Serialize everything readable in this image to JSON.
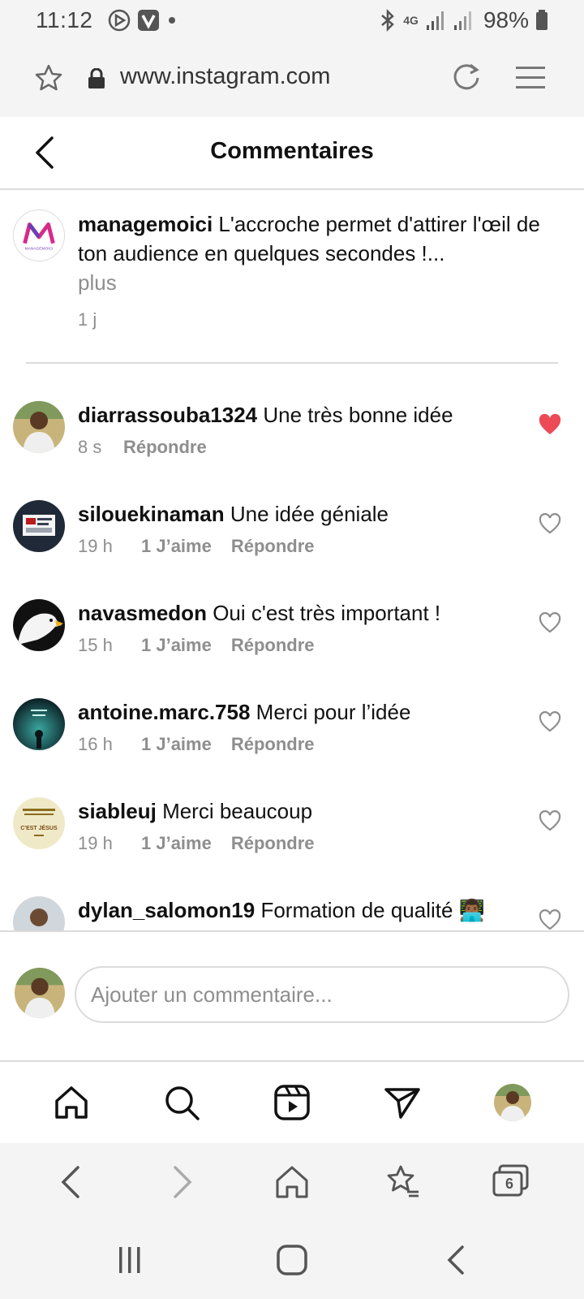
{
  "status_bar": {
    "time": "11:12",
    "network": "4G",
    "battery": "98%"
  },
  "browser": {
    "url": "www.instagram.com",
    "tab_count": "6"
  },
  "header": {
    "title": "Commentaires"
  },
  "caption": {
    "username": "managemoici",
    "text": "L'accroche permet d'attirer l'œil de ton audience en quelques secondes !...",
    "more_label": "plus",
    "time": "1 j",
    "avatar_text": "MANAGEMOICI"
  },
  "comments": [
    {
      "username": "diarrassouba1324",
      "text": "Une très bonne idée",
      "time": "8 s",
      "likes": "",
      "reply_label": "Répondre",
      "liked": true
    },
    {
      "username": "silouekinaman",
      "text": "Une idée géniale",
      "time": "19 h",
      "likes": "1 J’aime",
      "reply_label": "Répondre",
      "liked": false
    },
    {
      "username": "navasmedon",
      "text": "Oui c'est très important !",
      "time": "15 h",
      "likes": "1 J’aime",
      "reply_label": "Répondre",
      "liked": false
    },
    {
      "username": "antoine.marc.758",
      "text": "Merci pour l’idée",
      "time": "16 h",
      "likes": "1 J’aime",
      "reply_label": "Répondre",
      "liked": false
    },
    {
      "username": "siableuj",
      "text": "Merci beaucoup",
      "time": "19 h",
      "likes": "1 J’aime",
      "reply_label": "Répondre",
      "liked": false,
      "avatar_text": "C'EST JÉSUS"
    },
    {
      "username": "dylan_salomon19",
      "text": "Formation de qualité 👨🏾‍💻",
      "time": "",
      "likes": "",
      "reply_label": "",
      "liked": false
    }
  ],
  "add_comment": {
    "placeholder": "Ajouter un commentaire..."
  },
  "colors": {
    "liked_heart": "#ed4956",
    "muted_text": "#8e8e8e",
    "divider": "#dbdbdb",
    "chrome_bg": "#f4f4f4"
  }
}
